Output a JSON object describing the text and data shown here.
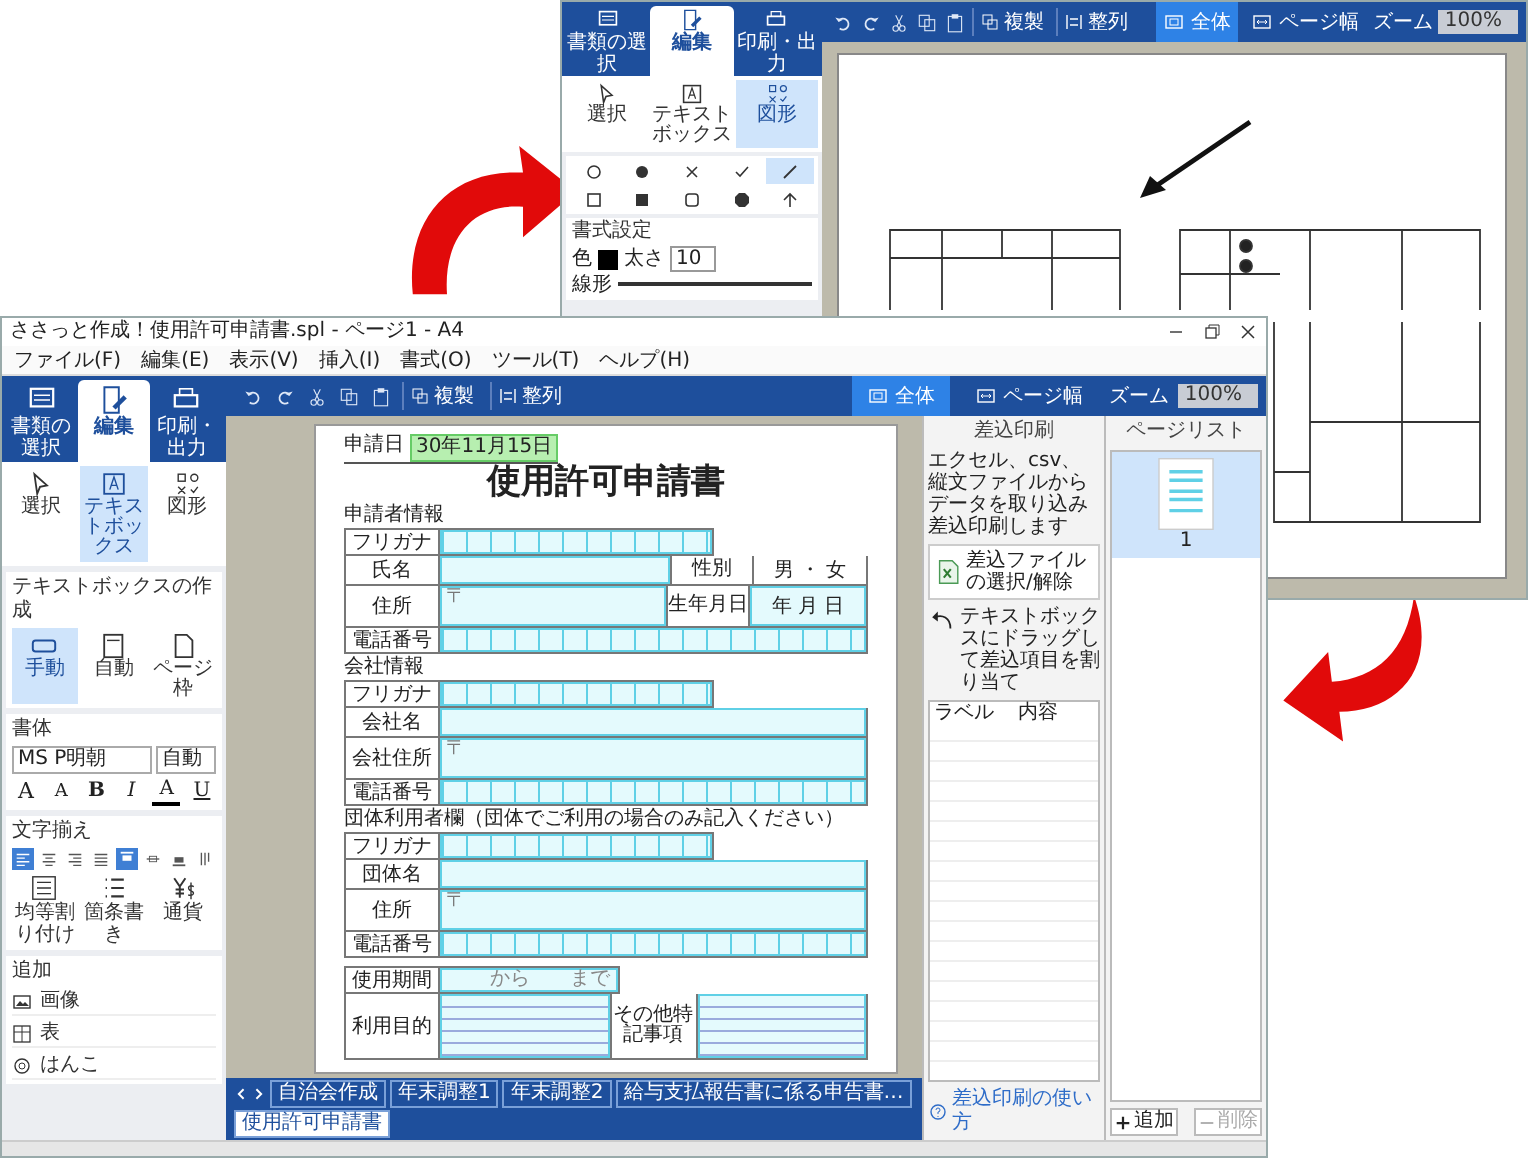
{
  "back_window": {
    "ribbon_tabs": [
      {
        "label": "書類の選択",
        "selected": false
      },
      {
        "label": "編集",
        "selected": true
      },
      {
        "label": "印刷・出力",
        "selected": false
      }
    ],
    "tools": [
      {
        "label": "選択",
        "selected": false
      },
      {
        "label": "テキストボックス",
        "selected": false
      },
      {
        "label": "図形",
        "selected": true
      }
    ],
    "shapes": [
      {
        "kind": "circle",
        "selected": false
      },
      {
        "kind": "dot",
        "selected": false
      },
      {
        "kind": "cross",
        "selected": false
      },
      {
        "kind": "check",
        "selected": false
      },
      {
        "kind": "line",
        "selected": true
      },
      {
        "kind": "square",
        "selected": false
      },
      {
        "kind": "filled-square",
        "selected": false
      },
      {
        "kind": "rounded-square",
        "selected": false
      },
      {
        "kind": "octagon",
        "selected": false
      },
      {
        "kind": "up-arrow",
        "selected": false
      }
    ],
    "format": {
      "title": "書式設定",
      "color_label": "色",
      "weight_label": "太さ",
      "weight_value": "10",
      "line_label": "線形"
    },
    "toolbar": {
      "buttons": [
        "複製",
        "整列"
      ]
    },
    "views": [
      {
        "label": "全体",
        "selected": true
      },
      {
        "label": "ページ幅",
        "selected": false
      }
    ],
    "zoom": {
      "label": "ズーム",
      "value": "100%"
    }
  },
  "front_window": {
    "title": "ささっと作成！使用許可申請書.spl - ページ1 - A4",
    "menu": [
      "ファイル(F)",
      "編集(E)",
      "表示(V)",
      "挿入(I)",
      "書式(O)",
      "ツール(T)",
      "ヘルプ(H)"
    ],
    "ribbon_tabs": [
      {
        "label": "書類の選択",
        "selected": false
      },
      {
        "label": "編集",
        "selected": true
      },
      {
        "label": "印刷・出力",
        "selected": false
      }
    ],
    "tools": [
      {
        "label": "選択",
        "selected": false
      },
      {
        "label": "テキストボックス",
        "selected": true
      },
      {
        "label": "図形",
        "selected": false
      }
    ],
    "textbox_create": {
      "title": "テキストボックスの作成",
      "options": [
        {
          "label": "手動",
          "selected": true
        },
        {
          "label": "自動",
          "selected": false
        },
        {
          "label": "ページ枠",
          "selected": false
        }
      ]
    },
    "font": {
      "title": "書体",
      "family": "MS P明朝",
      "size": "自動",
      "buttons": [
        "A",
        "A",
        "B",
        "I",
        "A",
        "U"
      ]
    },
    "alignment": {
      "title": "文字揃え",
      "buttons": [
        {
          "kind": "left",
          "selected": true
        },
        {
          "kind": "center",
          "selected": false
        },
        {
          "kind": "right",
          "selected": false
        },
        {
          "kind": "justify",
          "selected": false
        },
        {
          "kind": "top",
          "selected": true
        },
        {
          "kind": "middle",
          "selected": false
        },
        {
          "kind": "bottom",
          "selected": false
        },
        {
          "kind": "vertical",
          "selected": false
        }
      ]
    },
    "text_tools": [
      "均等割り付け",
      "箇条書き",
      "通貨"
    ],
    "add": {
      "title": "追加",
      "items": [
        "画像",
        "表",
        "はんこ"
      ]
    },
    "toolbar": {
      "buttons": [
        "複製",
        "整列"
      ]
    },
    "views": [
      {
        "label": "全体",
        "selected": true
      },
      {
        "label": "ページ幅",
        "selected": false
      }
    ],
    "zoom": {
      "label": "ズーム",
      "value": "100%"
    },
    "document": {
      "date_label": "申請日",
      "date_value": "30年11月15日",
      "title": "使用許可申請書",
      "sections": [
        {
          "heading": "申請者情報",
          "rows": [
            {
              "kind": "kana",
              "label": "フリガナ"
            },
            {
              "kind": "field",
              "label": "氏名",
              "side_label": "性別",
              "side_value": "男 ・ 女"
            },
            {
              "kind": "address",
              "label": "住所",
              "mark": "〒",
              "side_label": "生年月日",
              "side_value": "年 月 日"
            },
            {
              "kind": "phone",
              "label": "電話番号"
            }
          ]
        },
        {
          "heading": "会社情報",
          "rows": [
            {
              "kind": "kana",
              "label": "フリガナ"
            },
            {
              "kind": "field",
              "label": "会社名"
            },
            {
              "kind": "address",
              "label": "会社住所",
              "mark": "〒"
            },
            {
              "kind": "phone",
              "label": "電話番号"
            }
          ]
        },
        {
          "heading": "団体利用者欄（団体でご利用の場合のみ記入ください）",
          "rows": [
            {
              "kind": "kana",
              "label": "フリガナ"
            },
            {
              "kind": "field",
              "label": "団体名"
            },
            {
              "kind": "address",
              "label": "住所",
              "mark": "〒"
            },
            {
              "kind": "phone",
              "label": "電話番号"
            }
          ]
        }
      ],
      "usage": {
        "period_label": "使用期間",
        "period_value": "から　　まで",
        "purpose_label": "利用目的",
        "notes_label": "その他特記事項"
      }
    },
    "merge_panel": {
      "title": "差込印刷",
      "description": "エクセル、csv、縦文ファイルからデータを取り込み差込印刷します",
      "file_button": "差込ファイルの選択/解除",
      "hint": "テキストボックスにドラッグして差込項目を割り当て",
      "columns": [
        "ラベル",
        "内容"
      ],
      "help_link": "差込印刷の使い方"
    },
    "page_list": {
      "title": "ページリスト",
      "pages": [
        {
          "number": "1",
          "selected": true
        }
      ],
      "add_button": "追加",
      "delete_button": {
        "label": "削除",
        "disabled": true
      }
    },
    "sheet_tabs": [
      {
        "label": "自治会作成",
        "selected": false
      },
      {
        "label": "年末調整1",
        "selected": false
      },
      {
        "label": "年末調整2",
        "selected": false
      },
      {
        "label": "給与支払報告書に係る申告書…",
        "selected": false
      },
      {
        "label": "使用許可申請書",
        "selected": true
      }
    ]
  }
}
